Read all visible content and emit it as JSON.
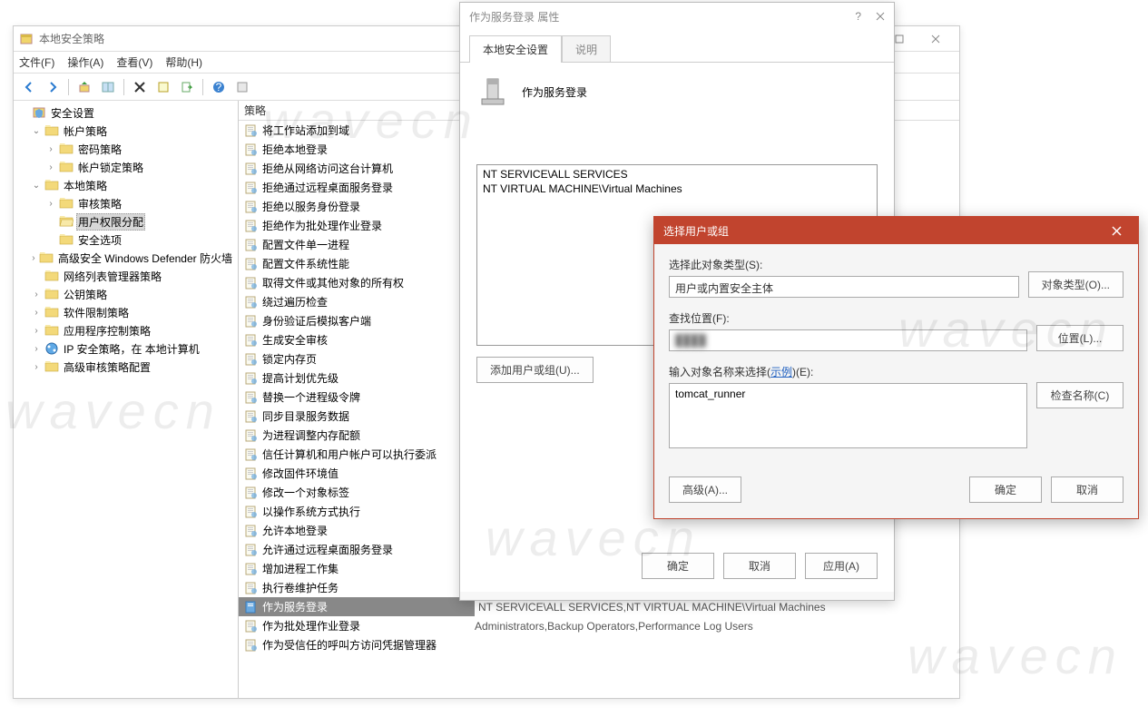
{
  "mmc": {
    "title": "本地安全策略",
    "menu": {
      "file": "文件(F)",
      "action": "操作(A)",
      "view": "查看(V)",
      "help": "帮助(H)"
    },
    "tree": [
      {
        "label": "安全设置",
        "indent": 0,
        "exp": "",
        "icon": "shield"
      },
      {
        "label": "帐户策略",
        "indent": 1,
        "exp": "v",
        "icon": "folder"
      },
      {
        "label": "密码策略",
        "indent": 2,
        "exp": ">",
        "icon": "folder"
      },
      {
        "label": "帐户锁定策略",
        "indent": 2,
        "exp": ">",
        "icon": "folder"
      },
      {
        "label": "本地策略",
        "indent": 1,
        "exp": "v",
        "icon": "folder"
      },
      {
        "label": "审核策略",
        "indent": 2,
        "exp": ">",
        "icon": "folder"
      },
      {
        "label": "用户权限分配",
        "indent": 2,
        "exp": "",
        "icon": "folder-open",
        "sel": true
      },
      {
        "label": "安全选项",
        "indent": 2,
        "exp": "",
        "icon": "folder"
      },
      {
        "label": "高级安全 Windows Defender 防火墙",
        "indent": 1,
        "exp": ">",
        "icon": "folder"
      },
      {
        "label": "网络列表管理器策略",
        "indent": 1,
        "exp": "",
        "icon": "folder"
      },
      {
        "label": "公钥策略",
        "indent": 1,
        "exp": ">",
        "icon": "folder"
      },
      {
        "label": "软件限制策略",
        "indent": 1,
        "exp": ">",
        "icon": "folder"
      },
      {
        "label": "应用程序控制策略",
        "indent": 1,
        "exp": ">",
        "icon": "folder"
      },
      {
        "label": "IP 安全策略，在 本地计算机",
        "indent": 1,
        "exp": ">",
        "icon": "ipsec"
      },
      {
        "label": "高级审核策略配置",
        "indent": 1,
        "exp": ">",
        "icon": "folder"
      }
    ],
    "list_header": {
      "col1": "策略"
    },
    "rows": [
      {
        "name": "将工作站添加到域",
        "sec": ""
      },
      {
        "name": "拒绝本地登录",
        "sec": ""
      },
      {
        "name": "拒绝从网络访问这台计算机",
        "sec": ""
      },
      {
        "name": "拒绝通过远程桌面服务登录",
        "sec": ""
      },
      {
        "name": "拒绝以服务身份登录",
        "sec": ""
      },
      {
        "name": "拒绝作为批处理作业登录",
        "sec": ""
      },
      {
        "name": "配置文件单一进程",
        "sec": ""
      },
      {
        "name": "配置文件系统性能",
        "sec": ""
      },
      {
        "name": "取得文件或其他对象的所有权",
        "sec": ""
      },
      {
        "name": "绕过遍历检查",
        "sec": ""
      },
      {
        "name": "身份验证后模拟客户端",
        "sec": ""
      },
      {
        "name": "生成安全审核",
        "sec": ""
      },
      {
        "name": "锁定内存页",
        "sec": ""
      },
      {
        "name": "提高计划优先级",
        "sec": ""
      },
      {
        "name": "替换一个进程级令牌",
        "sec": ""
      },
      {
        "name": "同步目录服务数据",
        "sec": ""
      },
      {
        "name": "为进程调整内存配额",
        "sec": ""
      },
      {
        "name": "信任计算机和用户帐户可以执行委派",
        "sec": ""
      },
      {
        "name": "修改固件环境值",
        "sec": ""
      },
      {
        "name": "修改一个对象标签",
        "sec": ""
      },
      {
        "name": "以操作系统方式执行",
        "sec": ""
      },
      {
        "name": "允许本地登录",
        "sec": ""
      },
      {
        "name": "允许通过远程桌面服务登录",
        "sec": ""
      },
      {
        "name": "增加进程工作集",
        "sec": ""
      },
      {
        "name": "执行卷维护任务",
        "sec": ""
      },
      {
        "name": "作为服务登录",
        "sec": "NT SERVICE\\ALL SERVICES,NT VIRTUAL MACHINE\\Virtual Machines",
        "sel": true
      },
      {
        "name": "作为批处理作业登录",
        "sec": "Administrators,Backup Operators,Performance Log Users"
      },
      {
        "name": "作为受信任的呼叫方访问凭据管理器",
        "sec": ""
      }
    ]
  },
  "prop": {
    "title": "作为服务登录 属性",
    "help_icon": "?",
    "tabs": {
      "active": "本地安全设置",
      "inactive": "说明"
    },
    "heading": "作为服务登录",
    "members": [
      "NT SERVICE\\ALL SERVICES",
      "NT VIRTUAL MACHINE\\Virtual Machines"
    ],
    "btn_add": "添加用户或组(U)...",
    "btn_ok": "确定",
    "btn_cancel": "取消",
    "btn_apply": "应用(A)"
  },
  "sel": {
    "title": "选择用户或组",
    "obj_type_label": "选择此对象类型(S):",
    "obj_type_value": "用户或内置安全主体",
    "btn_obj_type": "对象类型(O)...",
    "loc_label": "查找位置(F):",
    "loc_value": "████",
    "btn_loc": "位置(L)...",
    "name_label_prefix": "输入对象名称来选择(",
    "name_label_link": "示例",
    "name_label_suffix": ")(E):",
    "name_value": "tomcat_runner",
    "btn_check": "检查名称(C)",
    "btn_advanced": "高级(A)...",
    "btn_ok": "确定",
    "btn_cancel": "取消"
  }
}
